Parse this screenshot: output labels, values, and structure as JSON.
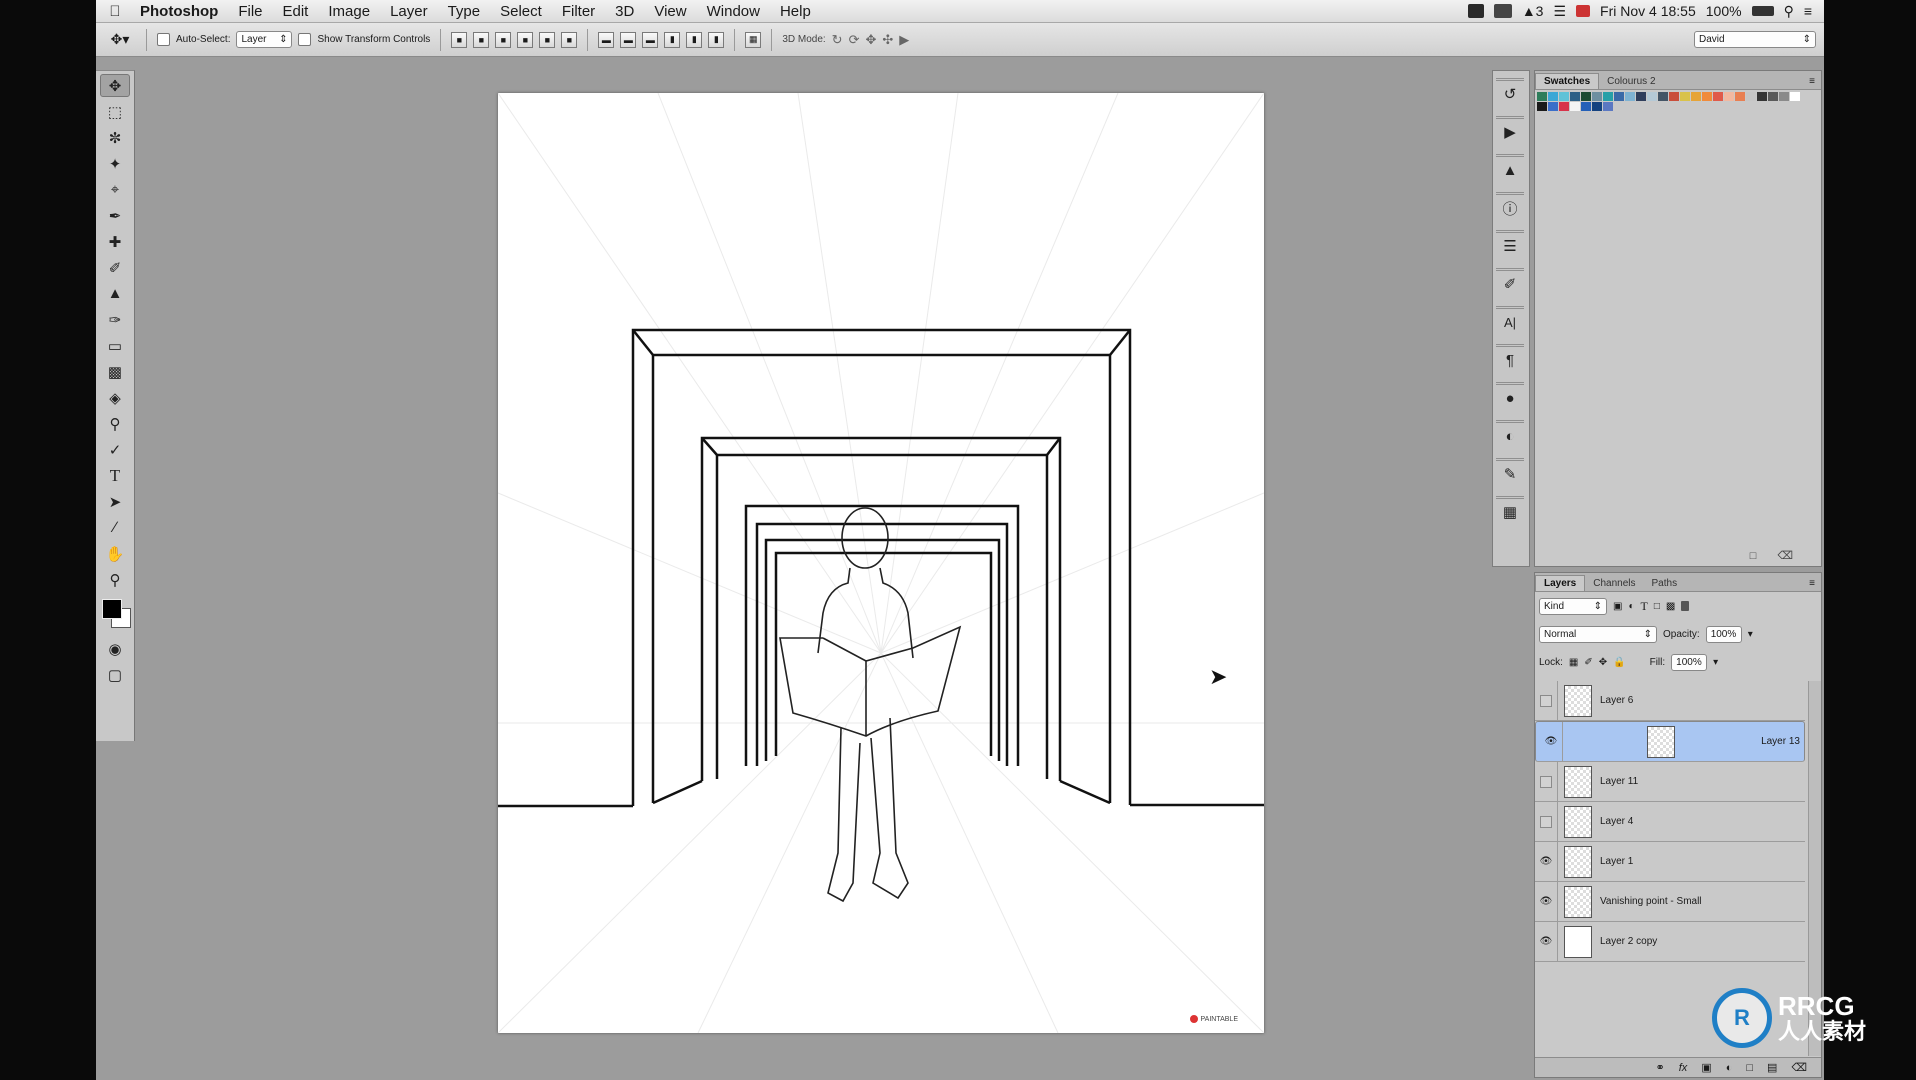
{
  "menubar": {
    "app_name": "Photoshop",
    "menus": [
      "File",
      "Edit",
      "Image",
      "Layer",
      "Type",
      "Select",
      "Filter",
      "3D",
      "View",
      "Window",
      "Help"
    ],
    "status": {
      "adobe_count": "3",
      "datetime": "Fri Nov 4  18:55",
      "battery": "100%"
    }
  },
  "options_bar": {
    "auto_select_label": "Auto-Select:",
    "auto_select_value": "Layer",
    "show_transform_label": "Show Transform Controls",
    "mode_3d_label": "3D Mode:",
    "workspace": "David"
  },
  "swatches_panel": {
    "tabs": [
      "Swatches",
      "Colourus 2"
    ],
    "colors": [
      "#2e7d5b",
      "#3ba7d6",
      "#5fc2d7",
      "#2c5f86",
      "#1b4b33",
      "#6e8fa0",
      "#27a0a8",
      "#3b6aa8",
      "#7fb3d3",
      "#2f3e5c",
      "#b5c9d6",
      "#445566",
      "#c94e3b",
      "#d9c24a",
      "#e6a438",
      "#f08b3b",
      "#e05a4a",
      "#f2b8a0",
      "#e87f52",
      "#c6c6c6",
      "#353535",
      "#5a5a5a",
      "#8a8a8a",
      "#ffffff",
      "#1a1a1a",
      "#3a6ec9",
      "#d8334a",
      "#f4f4f4",
      "#2460b8",
      "#14427f",
      "#5b78c2"
    ]
  },
  "layers_panel": {
    "tabs": [
      "Layers",
      "Channels",
      "Paths"
    ],
    "kind_label": "Kind",
    "blend_mode": "Normal",
    "opacity_label": "Opacity:",
    "opacity_value": "100%",
    "lock_label": "Lock:",
    "fill_label": "Fill:",
    "fill_value": "100%",
    "layers": [
      {
        "name": "Layer 6",
        "visible": false,
        "selected": false
      },
      {
        "name": "Layer 13",
        "visible": true,
        "selected": true
      },
      {
        "name": "Layer 11",
        "visible": false,
        "selected": false
      },
      {
        "name": "Layer 4",
        "visible": false,
        "selected": false
      },
      {
        "name": "Layer 1",
        "visible": true,
        "selected": false
      },
      {
        "name": "Vanishing point - Small",
        "visible": true,
        "selected": false
      },
      {
        "name": "Layer 2 copy",
        "visible": true,
        "selected": false
      }
    ]
  },
  "canvas": {
    "logo_text": "PAINTABLE"
  },
  "watermark": {
    "brand": "RRCG",
    "sub": "人人素材"
  },
  "icons": {
    "apple": "apple-icon",
    "move_tool": "move-icon",
    "cursor": "move-cursor-icon"
  }
}
